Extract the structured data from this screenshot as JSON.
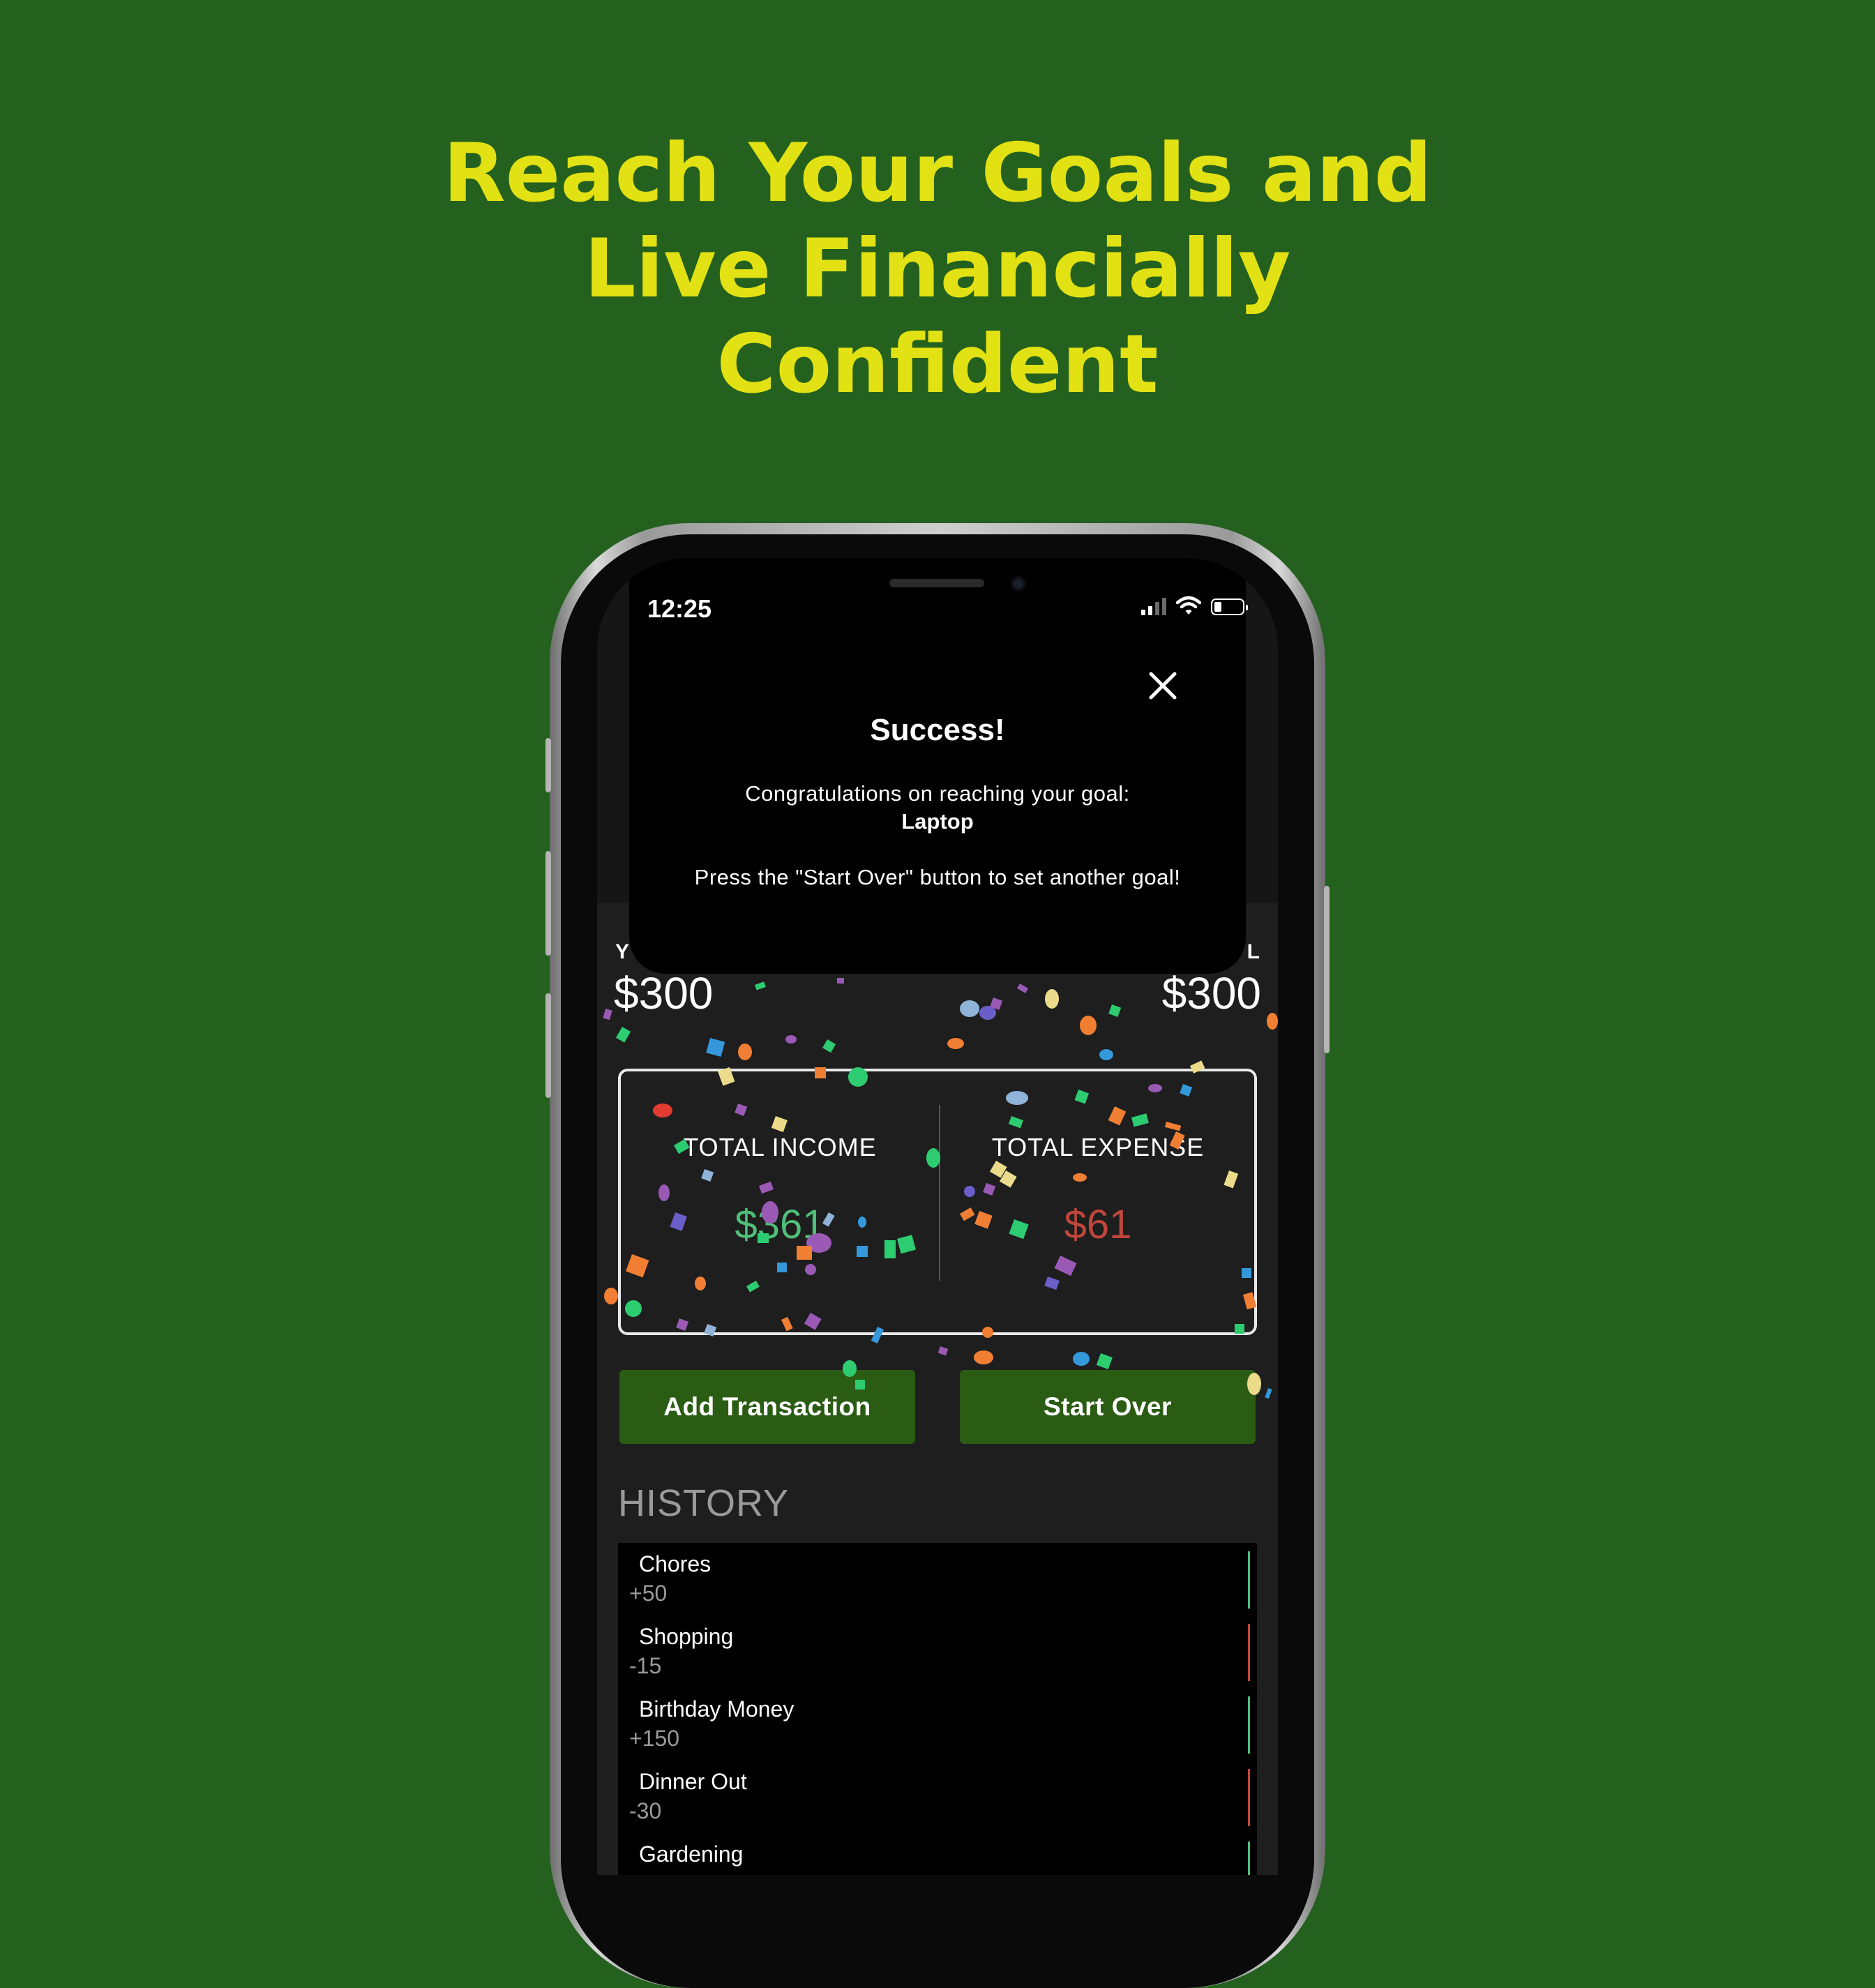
{
  "headline": {
    "line1": "Reach Your Goals and",
    "line2": "Live Financially",
    "line3": "Confident"
  },
  "status_bar": {
    "time": "12:25",
    "icons": [
      "cellular-signal-icon",
      "wifi-icon",
      "battery-icon"
    ]
  },
  "modal": {
    "title": "Success!",
    "message": "Congratulations on reaching your goal:",
    "goal_name": "Laptop",
    "instruction": "Press the \"Start Over\" button to set another goal!",
    "close_icon": "close-icon"
  },
  "goal_summary": {
    "left_label_partial": "Y",
    "left_value": "$300",
    "right_label_partial": "L",
    "right_value": "$300"
  },
  "totals": {
    "income_label": "TOTAL INCOME",
    "income_value": "$361",
    "expense_label": "TOTAL EXPENSE",
    "expense_value": "$61"
  },
  "buttons": {
    "add_transaction": "Add Transaction",
    "start_over": "Start Over"
  },
  "history": {
    "title": "HISTORY",
    "items": [
      {
        "name": "Chores",
        "amount": "+50",
        "type": "income"
      },
      {
        "name": "Shopping",
        "amount": "-15",
        "type": "expense"
      },
      {
        "name": "Birthday Money",
        "amount": "+150",
        "type": "income"
      },
      {
        "name": "Dinner Out",
        "amount": "-30",
        "type": "expense"
      },
      {
        "name": "Gardening",
        "amount": "",
        "type": "income"
      }
    ]
  },
  "colors": {
    "background": "#24611e",
    "headline": "#e1e113",
    "button": "#2a5c14",
    "income": "#4fbf7a",
    "expense": "#c0463c"
  }
}
